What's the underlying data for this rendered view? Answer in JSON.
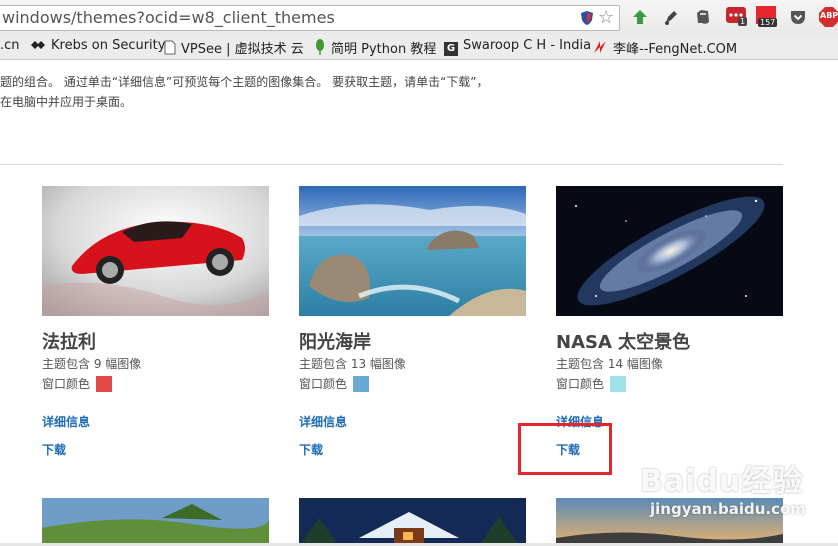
{
  "browser": {
    "url": "windows/themes?ocid=w8_client_themes",
    "bookmarks": [
      {
        "label": ".cn",
        "icon": "none"
      },
      {
        "label": "Krebs on Security",
        "icon": "krebs-icon"
      },
      {
        "label": "VPSee | 虚拟技术 云",
        "icon": "page-icon"
      },
      {
        "label": "简明 Python 教程",
        "icon": "python-leaf-icon"
      },
      {
        "label": "Swaroop C H - India",
        "icon": "g-icon"
      },
      {
        "label": "李峰--FengNet.COM",
        "icon": "fengnet-icon"
      }
    ],
    "extension_badges": {
      "evernote": "1",
      "calendar": "157"
    },
    "abp_label": "ABP"
  },
  "page": {
    "intro_lines": [
      "题的组合。 通过单击“详细信息”可预览每个主题的图像集合。 要获取主题，请单击“下载”，",
      "在电脑中并应用于桌面。"
    ]
  },
  "themes": [
    {
      "title": "法拉利",
      "count": "主题包含 9 幅图像",
      "color_label": "窗口颜色",
      "color": "#e34a4a",
      "details": "详细信息",
      "download": "下载"
    },
    {
      "title": "阳光海岸",
      "count": "主题包含 13 幅图像",
      "color_label": "窗口颜色",
      "color": "#6aa9d6",
      "details": "详细信息",
      "download": "下载"
    },
    {
      "title": "NASA 太空景色",
      "count": "主题包含 14 幅图像",
      "color_label": "窗口颜色",
      "color": "#9fe3e8",
      "details": "详细信息",
      "download": "下载"
    }
  ],
  "watermark": {
    "logo": "Baidu经验",
    "sub": "jingyan.baidu.com"
  }
}
